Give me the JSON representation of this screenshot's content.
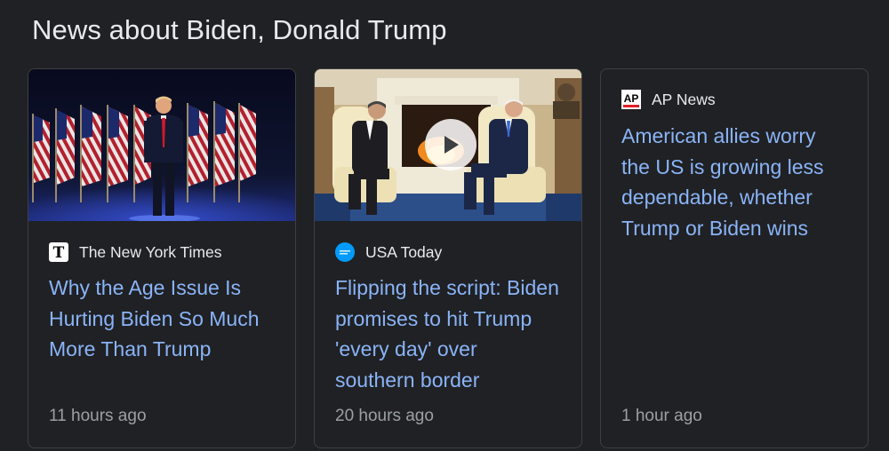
{
  "section": {
    "heading": "News about Biden, Donald Trump"
  },
  "cards": [
    {
      "source": "The New York Times",
      "source_logo_icon": "nyt-logo-icon",
      "title": "Why the Age Issue Is Hurting Biden So Much More Than Trump",
      "time": "11 hours ago",
      "thumbnail": "speaker-on-stage-with-american-flags-image",
      "has_video": false
    },
    {
      "source": "USA Today",
      "source_logo_icon": "usa-today-logo-icon",
      "title": "Flipping the script: Biden promises to hit Trump 'every day' over southern border",
      "time": "20 hours ago",
      "thumbnail": "leaders-seated-by-fireplace-image",
      "has_video": true
    },
    {
      "source": "AP News",
      "source_logo_icon": "ap-logo-icon",
      "logo_text": "AP",
      "title": "American allies worry the US is growing less dependable, whether Trump or Biden wins",
      "time": "1 hour ago",
      "has_video": false
    }
  ],
  "colors": {
    "background": "#202124",
    "card_border": "#3c4043",
    "headline_link": "#8ab4f8",
    "primary_text": "#e8eaed",
    "secondary_text": "#9aa0a6",
    "usa_today_blue": "#009bff",
    "ap_red": "#e11f26"
  }
}
